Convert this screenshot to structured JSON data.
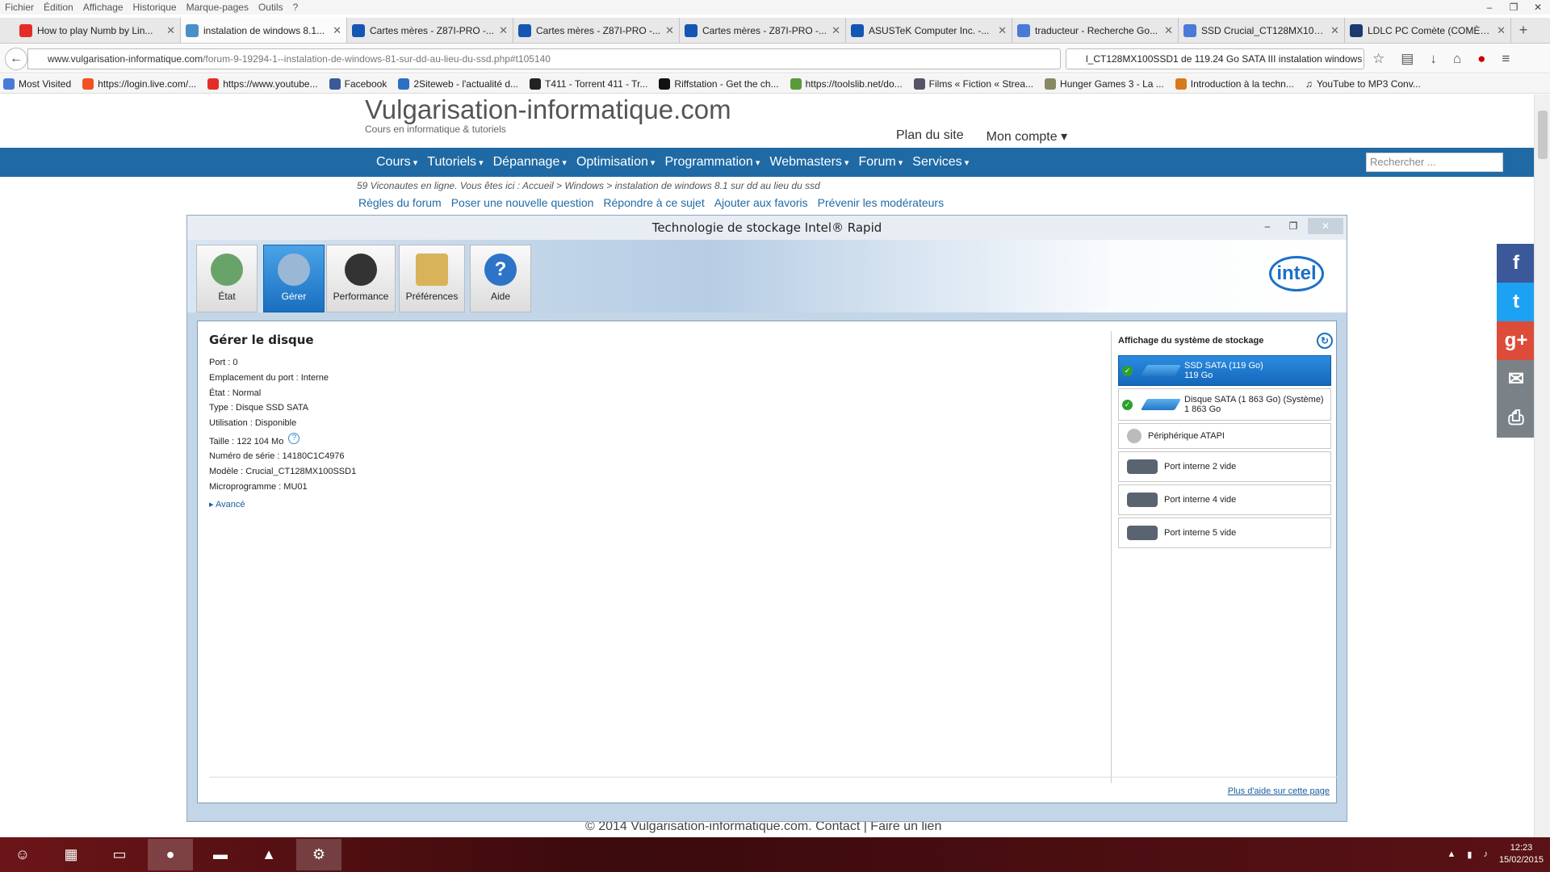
{
  "menu": [
    "Fichier",
    "Édition",
    "Affichage",
    "Historique",
    "Marque-pages",
    "Outils",
    "?"
  ],
  "window_controls": [
    "–",
    "❐",
    "✕"
  ],
  "tabs": [
    {
      "title": "How to play Numb by Lin...",
      "icon": "youtube-icon"
    },
    {
      "title": "instalation de windows 8.1...",
      "icon": "vi-icon",
      "active": true
    },
    {
      "title": "Cartes mères - Z87I-PRO -...",
      "icon": "asus-icon"
    },
    {
      "title": "Cartes mères - Z87I-PRO -...",
      "icon": "asus-icon"
    },
    {
      "title": "Cartes mères - Z87I-PRO -...",
      "icon": "asus-icon"
    },
    {
      "title": "ASUSTeK Computer Inc. -...",
      "icon": "asus-icon"
    },
    {
      "title": "traducteur - Recherche Go...",
      "icon": "google-icon"
    },
    {
      "title": "SSD Crucial_CT128MX100...",
      "icon": "google-icon"
    },
    {
      "title": "LDLC PC Comète (COMÈT...",
      "icon": "ldlc-icon"
    }
  ],
  "url": {
    "domain": "www.vulgarisation-informatique.com",
    "path": "/forum-9-19294-1--instalation-de-windows-81-sur-dd-au-lieu-du-ssd.php#t105140"
  },
  "search_text": "l_CT128MX100SSD1 de 119.24 Go SATA III instalation windows",
  "bookmarks": [
    "Most Visited",
    "https://login.live.com/...",
    "https://www.youtube...",
    "Facebook",
    "2Siteweb - l'actualité d...",
    "T411 - Torrent 411 - Tr...",
    "Riffstation - Get the ch...",
    "https://toolslib.net/do...",
    "Films « Fiction « Strea...",
    "Hunger Games 3 - La ...",
    "Introduction à la techn...",
    "YouTube to MP3 Conv..."
  ],
  "site": {
    "title": "Vulgarisation-informatique.com",
    "subtitle": "Cours en informatique & tutoriels",
    "links": [
      "Plan du site",
      "Mon compte ▾"
    ],
    "nav": [
      "Cours",
      "Tutoriels",
      "Dépannage",
      "Optimisation",
      "Programmation",
      "Webmasters",
      "Forum",
      "Services"
    ],
    "search_placeholder": "Rechercher ...",
    "breadcrumb": "59 Viconautes en ligne. Vous êtes ici : Accueil > Windows > instalation de windows 8.1 sur dd au lieu du ssd",
    "actions": [
      "Règles du forum",
      "Poser une nouvelle question",
      "Répondre à ce sujet",
      "Ajouter aux favoris",
      "Prévenir les modérateurs"
    ],
    "footer": "© 2014 Vulgarisation-informatique.com. Contact | Faire un lien"
  },
  "social": [
    {
      "label": "f",
      "color": "#3b5998",
      "icon": "facebook-icon"
    },
    {
      "label": "t",
      "color": "#1da1f2",
      "icon": "twitter-icon"
    },
    {
      "label": "g+",
      "color": "#dd4b39",
      "icon": "googleplus-icon"
    },
    {
      "label": "✉",
      "color": "#7a8288",
      "icon": "mail-icon"
    },
    {
      "label": "⎙",
      "color": "#7a8288",
      "icon": "print-icon"
    }
  ],
  "rst": {
    "title": "Technologie de stockage Intel® Rapid",
    "tools": [
      "État",
      "Gérer",
      "Performance",
      "Préférences",
      "Aide"
    ],
    "intel": "intel",
    "detail": {
      "heading": "Gérer le disque",
      "rows": [
        "Port : 0",
        "Emplacement du port : Interne",
        "État : Normal",
        "Type : Disque SSD SATA",
        "Utilisation : Disponible",
        "Taille : 122 104 Mo",
        "Numéro de série : 14180C1C4976",
        "Modèle : Crucial_CT128MX100SSD1",
        "Microprogramme : MU01"
      ],
      "advanced": "Avancé"
    },
    "storage": {
      "heading": "Affichage du système de stockage",
      "items": [
        {
          "line1": "SSD SATA (119 Go)",
          "line2": "119 Go"
        },
        {
          "line1": "Disque SATA (1 863 Go) (Système)",
          "line2": "1 863 Go"
        },
        {
          "line1": "Périphérique ATAPI",
          "line2": ""
        },
        {
          "line1": "Port interne 2 vide",
          "line2": ""
        },
        {
          "line1": "Port interne 4 vide",
          "line2": ""
        },
        {
          "line1": "Port interne 5 vide",
          "line2": ""
        }
      ]
    },
    "help_link": "Plus d'aide sur cette page"
  },
  "taskbar": {
    "clock_time": "12:23",
    "clock_date": "15/02/2015"
  }
}
